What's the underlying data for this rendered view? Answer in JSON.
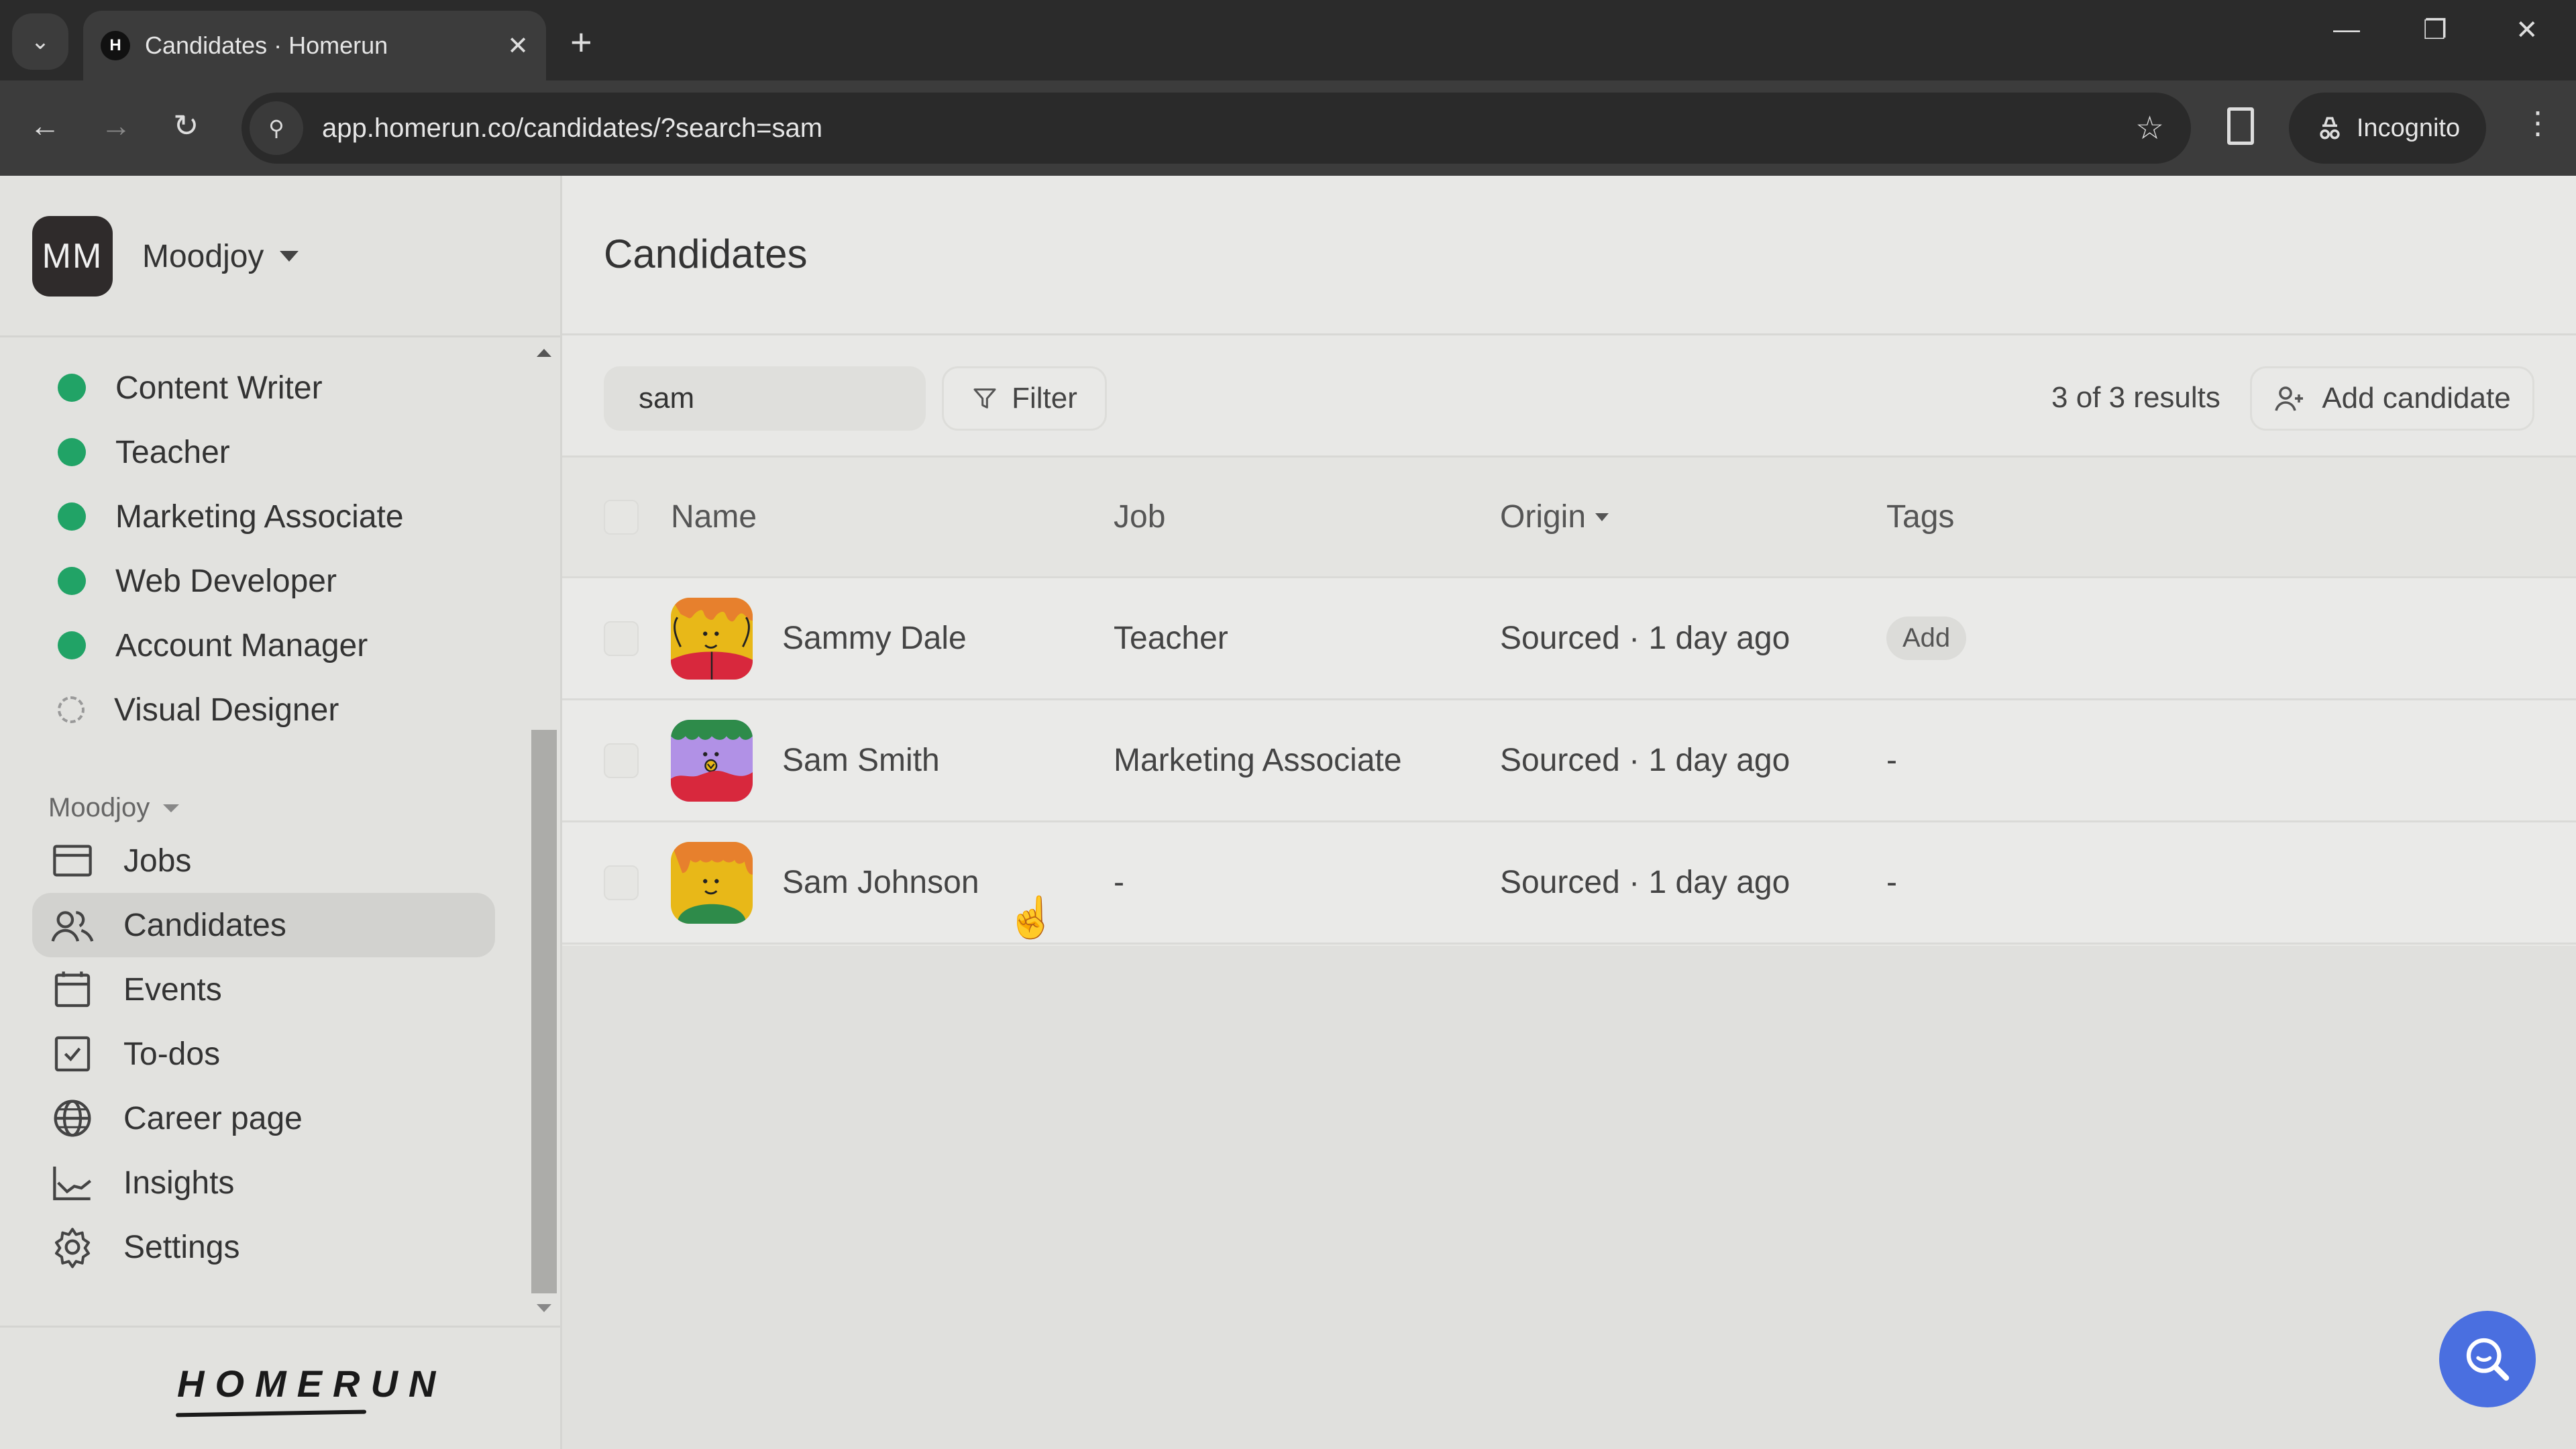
{
  "browser": {
    "tab_title": "Candidates · Homerun",
    "favicon_letter": "H",
    "url": "app.homerun.co/candidates/?search=sam",
    "incognito_label": "Incognito",
    "icons": {
      "tab_search": "chevron-down-icon",
      "close_tab": "close-icon",
      "new_tab": "plus-icon",
      "minimize": "minimize-icon",
      "restore": "restore-icon",
      "close_window": "close-icon",
      "back": "arrow-left-icon",
      "forward": "arrow-right-icon",
      "reload": "reload-icon",
      "site_info": "tune-icon",
      "bookmark": "star-icon",
      "side_panel": "side-panel-icon",
      "incognito": "incognito-icon",
      "menu": "kebab-icon"
    },
    "glyphs": {
      "tab_search": "⌄",
      "close_tab": "✕",
      "new_tab": "+",
      "minimize": "—",
      "restore": "❐",
      "close_window": "✕",
      "back": "←",
      "forward": "→",
      "reload": "↻",
      "site_info": "⚲",
      "bookmark": "☆",
      "menu": "⋮"
    }
  },
  "sidebar": {
    "org_initials": "MM",
    "org_name": "Moodjoy",
    "jobs": [
      {
        "label": "Content Writer",
        "status": "published"
      },
      {
        "label": "Teacher",
        "status": "published"
      },
      {
        "label": "Marketing Associate",
        "status": "published"
      },
      {
        "label": "Web Developer",
        "status": "published"
      },
      {
        "label": "Account Manager",
        "status": "published"
      },
      {
        "label": "Visual Designer",
        "status": "draft"
      }
    ],
    "section_label": "Moodjoy",
    "nav": [
      {
        "label": "Jobs",
        "icon": "jobs-icon",
        "active": false
      },
      {
        "label": "Candidates",
        "icon": "candidates-icon",
        "active": true
      },
      {
        "label": "Events",
        "icon": "calendar-icon",
        "active": false
      },
      {
        "label": "To-dos",
        "icon": "checkbox-icon",
        "active": false
      },
      {
        "label": "Career page",
        "icon": "globe-icon",
        "active": false
      },
      {
        "label": "Insights",
        "icon": "chart-icon",
        "active": false
      },
      {
        "label": "Settings",
        "icon": "gear-icon",
        "active": false
      }
    ],
    "logo": "HOMERUN"
  },
  "main": {
    "title": "Candidates",
    "search": {
      "value": "sam",
      "clear_glyph": "✕"
    },
    "filter_label": "Filter",
    "results_text": "3 of 3 results",
    "add_candidate_label": "Add candidate",
    "columns": {
      "name": "Name",
      "job": "Job",
      "origin": "Origin",
      "tags": "Tags"
    },
    "rows": [
      {
        "name": "Sammy Dale",
        "job": "Teacher",
        "origin": "Sourced · 1 day ago",
        "tags": "Add",
        "tags_is_button": true,
        "avatar": "avatar-sammy"
      },
      {
        "name": "Sam Smith",
        "job": "Marketing Associate",
        "origin": "Sourced · 1 day ago",
        "tags": "-",
        "tags_is_button": false,
        "avatar": "avatar-smith"
      },
      {
        "name": "Sam Johnson",
        "job": "-",
        "origin": "Sourced · 1 day ago",
        "tags": "-",
        "tags_is_button": false,
        "avatar": "avatar-johnson"
      }
    ]
  },
  "colors": {
    "status_published": "#21a366",
    "help_button": "#4a6fe0",
    "sidebar_bg": "#e2e2df",
    "main_bg": "#e8e8e6"
  },
  "help_button_icon": "search-help-icon"
}
